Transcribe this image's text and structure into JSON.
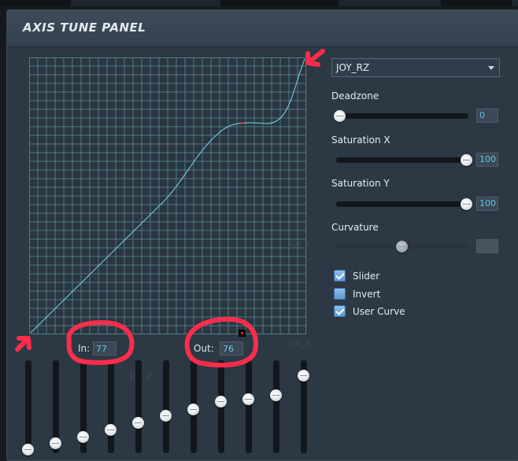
{
  "panel": {
    "title": "AXIS TUNE PANEL"
  },
  "graph": {
    "x_axis_name": "JOY_X",
    "y_axis_name": "JOY_Y",
    "z_axis_name": "JOY_Z",
    "in_label": "In:",
    "in_value": "77",
    "out_label": "Out:",
    "out_value": "76",
    "curve_color": "#7fd6ee",
    "grid_color": "#4f7b86"
  },
  "sliders": {
    "count": 11,
    "levels_fraction": [
      0.0,
      0.08,
      0.16,
      0.25,
      0.33,
      0.42,
      0.5,
      0.6,
      0.63,
      0.68,
      0.92
    ]
  },
  "axis_select": {
    "selected": "JOY_RZ"
  },
  "settings": {
    "deadzone": {
      "label": "Deadzone",
      "value": "0",
      "fraction": 0.0
    },
    "saturation_x": {
      "label": "Saturation X",
      "value": "100",
      "fraction": 1.0
    },
    "saturation_y": {
      "label": "Saturation Y",
      "value": "100",
      "fraction": 1.0
    },
    "curvature": {
      "label": "Curvature",
      "value": "",
      "fraction": 0.5,
      "disabled": true
    }
  },
  "checkboxes": [
    {
      "label": "Slider",
      "checked": true
    },
    {
      "label": "Invert",
      "checked": false
    },
    {
      "label": "User Curve",
      "checked": true
    }
  ],
  "colors": {
    "accent": "#64c8e8",
    "annotation": "#ff2d4b",
    "panel_bg": "#2c3945"
  }
}
